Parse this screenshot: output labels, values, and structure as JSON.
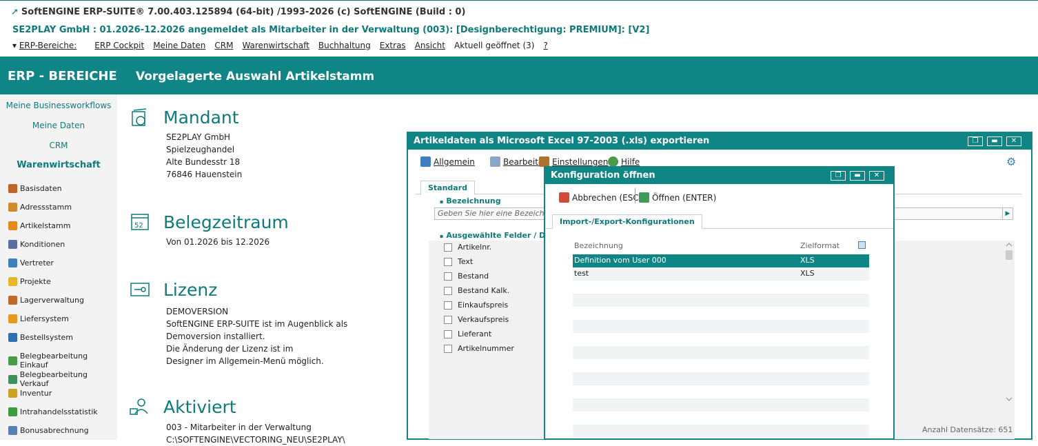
{
  "app": {
    "title": "SoftENGINE ERP-SUITE® 7.00.403.125894 (64-bit) /1993-2026 (c) SoftENGINE (Build : 0)",
    "session": "SE2PLAY GmbH : 01.2026-12.2026 angemeldet als Mitarbeiter in der Verwaltung (003): [Designberechtigung: PREMIUM]: [V2]"
  },
  "menu": [
    "ERP-Bereiche:",
    "ERP Cockpit",
    "Meine Daten",
    "CRM",
    "Warenwirtschaft",
    "Buchhaltung",
    "Extras",
    "Ansicht",
    "Aktuell geöffnet (3)",
    "?"
  ],
  "band": {
    "left": "ERP - BEREICHE",
    "right": "Vorgelagerte Auswahl Artikelstamm"
  },
  "sidebar": {
    "links": [
      "Meine Businessworkflows",
      "Meine Daten",
      "CRM"
    ],
    "section": "Warenwirtschaft",
    "items": [
      {
        "label": "Basisdaten",
        "color": "#c0632b"
      },
      {
        "label": "Adressstamm",
        "color": "#d08a2a"
      },
      {
        "label": "Artikelstamm",
        "color": "#e28b1c"
      },
      {
        "label": "Konditionen",
        "color": "#5a6fa0"
      },
      {
        "label": "Vertreter",
        "color": "#3f7fbf"
      },
      {
        "label": "Projekte",
        "color": "#e8b62a"
      },
      {
        "label": "Lagerverwaltung",
        "color": "#c2682a"
      },
      {
        "label": "Liefersystem",
        "color": "#e39a1f"
      },
      {
        "label": "Bestellsystem",
        "color": "#2f6fb0"
      },
      {
        "label": "Belegbearbeitung Einkauf",
        "color": "#4a9a4a"
      },
      {
        "label": "Belegbearbeitung Verkauf",
        "color": "#3e8e5e"
      },
      {
        "label": "Inventur",
        "color": "#c9a227"
      },
      {
        "label": "Intrahandelsstatistik",
        "color": "#3f9a3f"
      },
      {
        "label": "Bonusabrechnung",
        "color": "#5a7fb5"
      }
    ]
  },
  "sections": {
    "mandant": {
      "title": "Mandant",
      "lines": [
        "SE2PLAY GmbH",
        "Spielzeughandel",
        "Alte Bundesstr 18",
        "76846 Hauenstein"
      ]
    },
    "belegzeitraum": {
      "title": "Belegzeitraum",
      "lines": [
        "Von 01.2026 bis 12.2026"
      ]
    },
    "lizenz": {
      "title": "Lizenz",
      "lines": [
        "DEMOVERSION",
        "SoftENGINE ERP-SUITE ist im Augenblick als",
        "Demoversion installiert.",
        "Die Änderung der Lizenz ist im",
        "Designer im Allgemein-Menü möglich."
      ]
    },
    "aktiviert": {
      "title": "Aktiviert",
      "lines": [
        "003 - Mitarbeiter in der Verwaltung",
        "C:\\SOFTENGINE\\VECTORING_NEU\\SE2PLAY\\"
      ]
    }
  },
  "dialog_export": {
    "title": "Artikeldaten als Microsoft Excel 97-2003 (.xls) exportieren",
    "toolbar": [
      "Allgemein",
      "Bearbeiten",
      "Einstellungen",
      "Hilfe"
    ],
    "tab": "Standard",
    "group_bezeichnung": "Bezeichnung",
    "bez_placeholder": "Geben Sie hier eine Bezeichnung",
    "group_felder": "Ausgewählte Felder / Date",
    "fields": [
      "Artikelnr.",
      "Text",
      "Bestand",
      "Bestand Kalk.",
      "Einkaufspreis",
      "Verkaufspreis",
      "Lieferant",
      "Artikelnummer"
    ],
    "count": "Anzahl Datensätze: 651"
  },
  "dialog_config": {
    "title": "Konfiguration öffnen",
    "btn_cancel": "Abbrechen (ESC)",
    "btn_open": "Öffnen (ENTER)",
    "tab": "Import-/Export-Konfigurationen",
    "col_bez": "Bezeichnung",
    "col_ziel": "Zielformat",
    "rows": [
      {
        "bez": "Definition vom User 000",
        "ziel": "XLS"
      },
      {
        "bez": "test",
        "ziel": "XLS"
      }
    ]
  },
  "colors": {
    "accent": "#108585"
  }
}
